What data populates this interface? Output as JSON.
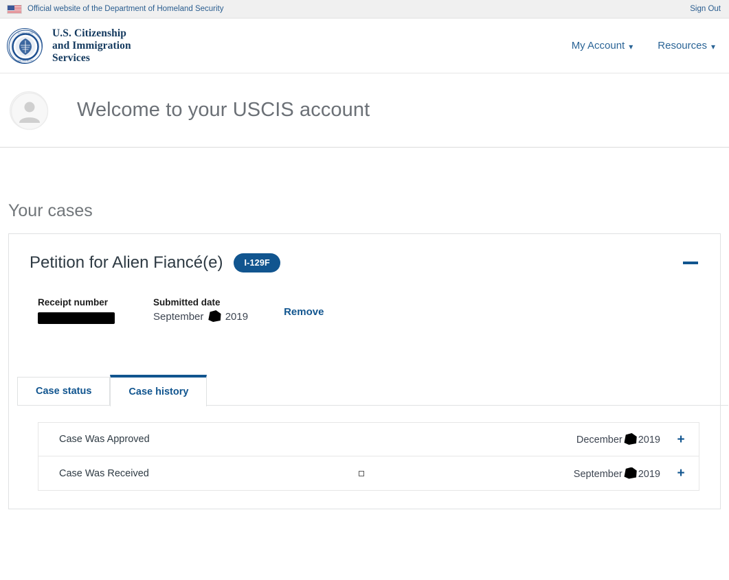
{
  "gov_banner": {
    "flag_icon": "us-flag-icon",
    "text": "Official website of the Department of Homeland Security",
    "sign_out_label": "Sign Out"
  },
  "masthead": {
    "seal_icon": "dhs-seal-icon",
    "agency_line1": "U.S. Citizenship",
    "agency_line2": "and Immigration",
    "agency_line3": "Services",
    "nav": [
      {
        "label": "My Account",
        "caret": "⌄"
      },
      {
        "label": "Resources",
        "caret": "⌄"
      }
    ]
  },
  "welcome": {
    "avatar_icon": "user-avatar-icon",
    "title": "Welcome to your USCIS account"
  },
  "main": {
    "section_title": "Your cases",
    "case": {
      "title": "Petition for Alien Fiancé(e)",
      "form_badge": "I-129F",
      "collapse_icon": "minus-icon",
      "receipt_label": "Receipt number",
      "receipt_value": "",
      "submitted_label": "Submitted date",
      "submitted_month": "September",
      "submitted_year": "2019",
      "remove_label": "Remove",
      "tabs": [
        {
          "label": "Case status",
          "active": false
        },
        {
          "label": "Case history",
          "active": true
        }
      ],
      "history": [
        {
          "label": "Case Was Approved",
          "month": "December",
          "year": "2019",
          "expand_icon": "plus-icon",
          "has_glyph_box": false
        },
        {
          "label": "Case Was Received",
          "month": "September",
          "year": "2019",
          "expand_icon": "plus-icon",
          "has_glyph_box": true
        }
      ]
    }
  },
  "colors": {
    "brand_blue": "#11558f",
    "link_blue": "#2a6496",
    "banner_bg": "#f0f0f0",
    "muted_text": "#71767a",
    "border": "#dfe1e2"
  }
}
